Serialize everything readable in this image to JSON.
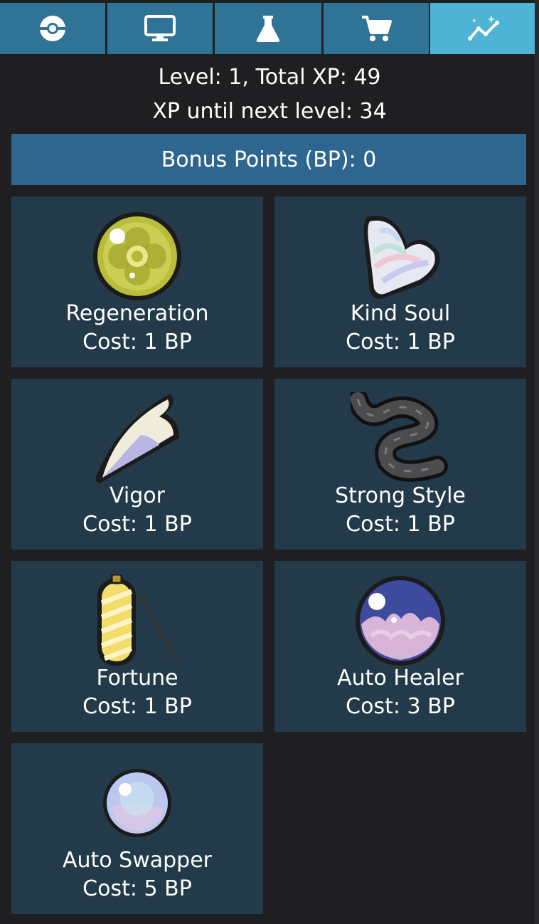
{
  "tabs": [
    {
      "icon": "pokeball-icon",
      "active": false
    },
    {
      "icon": "monitor-icon",
      "active": false
    },
    {
      "icon": "flask-icon",
      "active": false
    },
    {
      "icon": "cart-icon",
      "active": false
    },
    {
      "icon": "sparkle-chart-icon",
      "active": true
    }
  ],
  "level_text": "Level: 1, Total XP: 49",
  "xp_text": "XP until next level: 34",
  "bonus_points": "Bonus Points (BP): 0",
  "upgrades": [
    {
      "name": "Regeneration",
      "cost": "Cost: 1 BP",
      "icon": "regeneration-orb-icon"
    },
    {
      "name": "Kind Soul",
      "cost": "Cost: 1 BP",
      "icon": "pastel-heart-icon"
    },
    {
      "name": "Vigor",
      "cost": "Cost: 1 BP",
      "icon": "fang-icon"
    },
    {
      "name": "Strong Style",
      "cost": "Cost: 1 BP",
      "icon": "black-belt-icon"
    },
    {
      "name": "Fortune",
      "cost": "Cost: 1 BP",
      "icon": "charm-icon"
    },
    {
      "name": "Auto Healer",
      "cost": "Cost: 3 BP",
      "icon": "blue-orb-icon"
    },
    {
      "name": "Auto Swapper",
      "cost": "Cost: 5 BP",
      "icon": "pearl-orb-icon"
    }
  ],
  "colors": {
    "tab": "#2f7496",
    "tab_active": "#4fb3d5",
    "bp_bar": "#2f6690",
    "card": "#233a4a",
    "background": "#1f1f21"
  }
}
